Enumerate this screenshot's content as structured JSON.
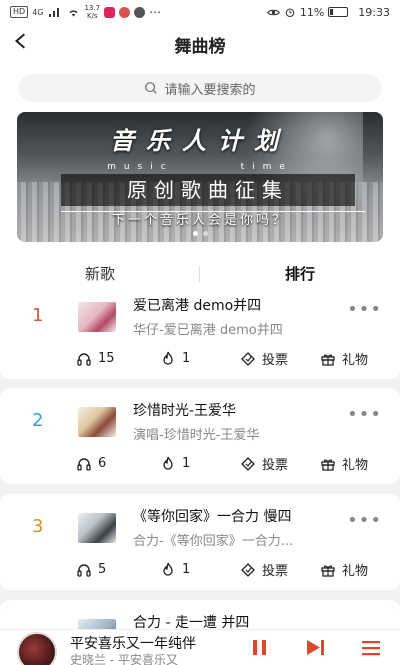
{
  "status_bar": {
    "network_chip": "HD",
    "signal_label": "4G",
    "speed_value": "13.7",
    "speed_unit": "K/s",
    "battery": "11%",
    "time": "19:33"
  },
  "header": {
    "title": "舞曲榜"
  },
  "search": {
    "placeholder": "请输入要搜索的"
  },
  "banner": {
    "title": "音乐人计划",
    "sub_left": "music",
    "sub_right": "time",
    "box_text": "原创歌曲征集",
    "tagline": "下一个音乐人会是你吗？"
  },
  "tabs": [
    {
      "label": "新歌",
      "active": false
    },
    {
      "label": "排行",
      "active": true
    }
  ],
  "songs": [
    {
      "rank": "1",
      "rank_color": "#d05a3c",
      "title": "爱已离港 demo并四",
      "subtitle": "华仔-爱已离港 demo并四",
      "listens": "15",
      "likes": "1",
      "vote_label": "投票",
      "gift_label": "礼物"
    },
    {
      "rank": "2",
      "rank_color": "#3aa0c8",
      "title": "珍惜时光-王爱华",
      "subtitle": "演唱-珍惜时光-王爱华",
      "listens": "6",
      "likes": "1",
      "vote_label": "投票",
      "gift_label": "礼物"
    },
    {
      "rank": "3",
      "rank_color": "#d0922c",
      "title": "《等你回家》一合力 慢四",
      "subtitle": "合力-《等你回家》一合力...",
      "listens": "5",
      "likes": "1",
      "vote_label": "投票",
      "gift_label": "礼物"
    },
    {
      "rank": "",
      "rank_color": "#888888",
      "title": "合力 - 走一遭 并四",
      "subtitle": "",
      "listens": "",
      "likes": "",
      "vote_label": "",
      "gift_label": ""
    }
  ],
  "player": {
    "title": "平安喜乐又一年纯伴",
    "subtitle": "史晓兰 - 平安喜乐又"
  },
  "colors": {
    "accent": "#e0452f",
    "muted": "#888888"
  },
  "icons": [
    "back-arrow-icon",
    "search-icon",
    "headphones-icon",
    "flame-icon",
    "vote-icon",
    "gift-icon",
    "more-icon",
    "pause-icon",
    "next-icon",
    "playlist-icon"
  ]
}
